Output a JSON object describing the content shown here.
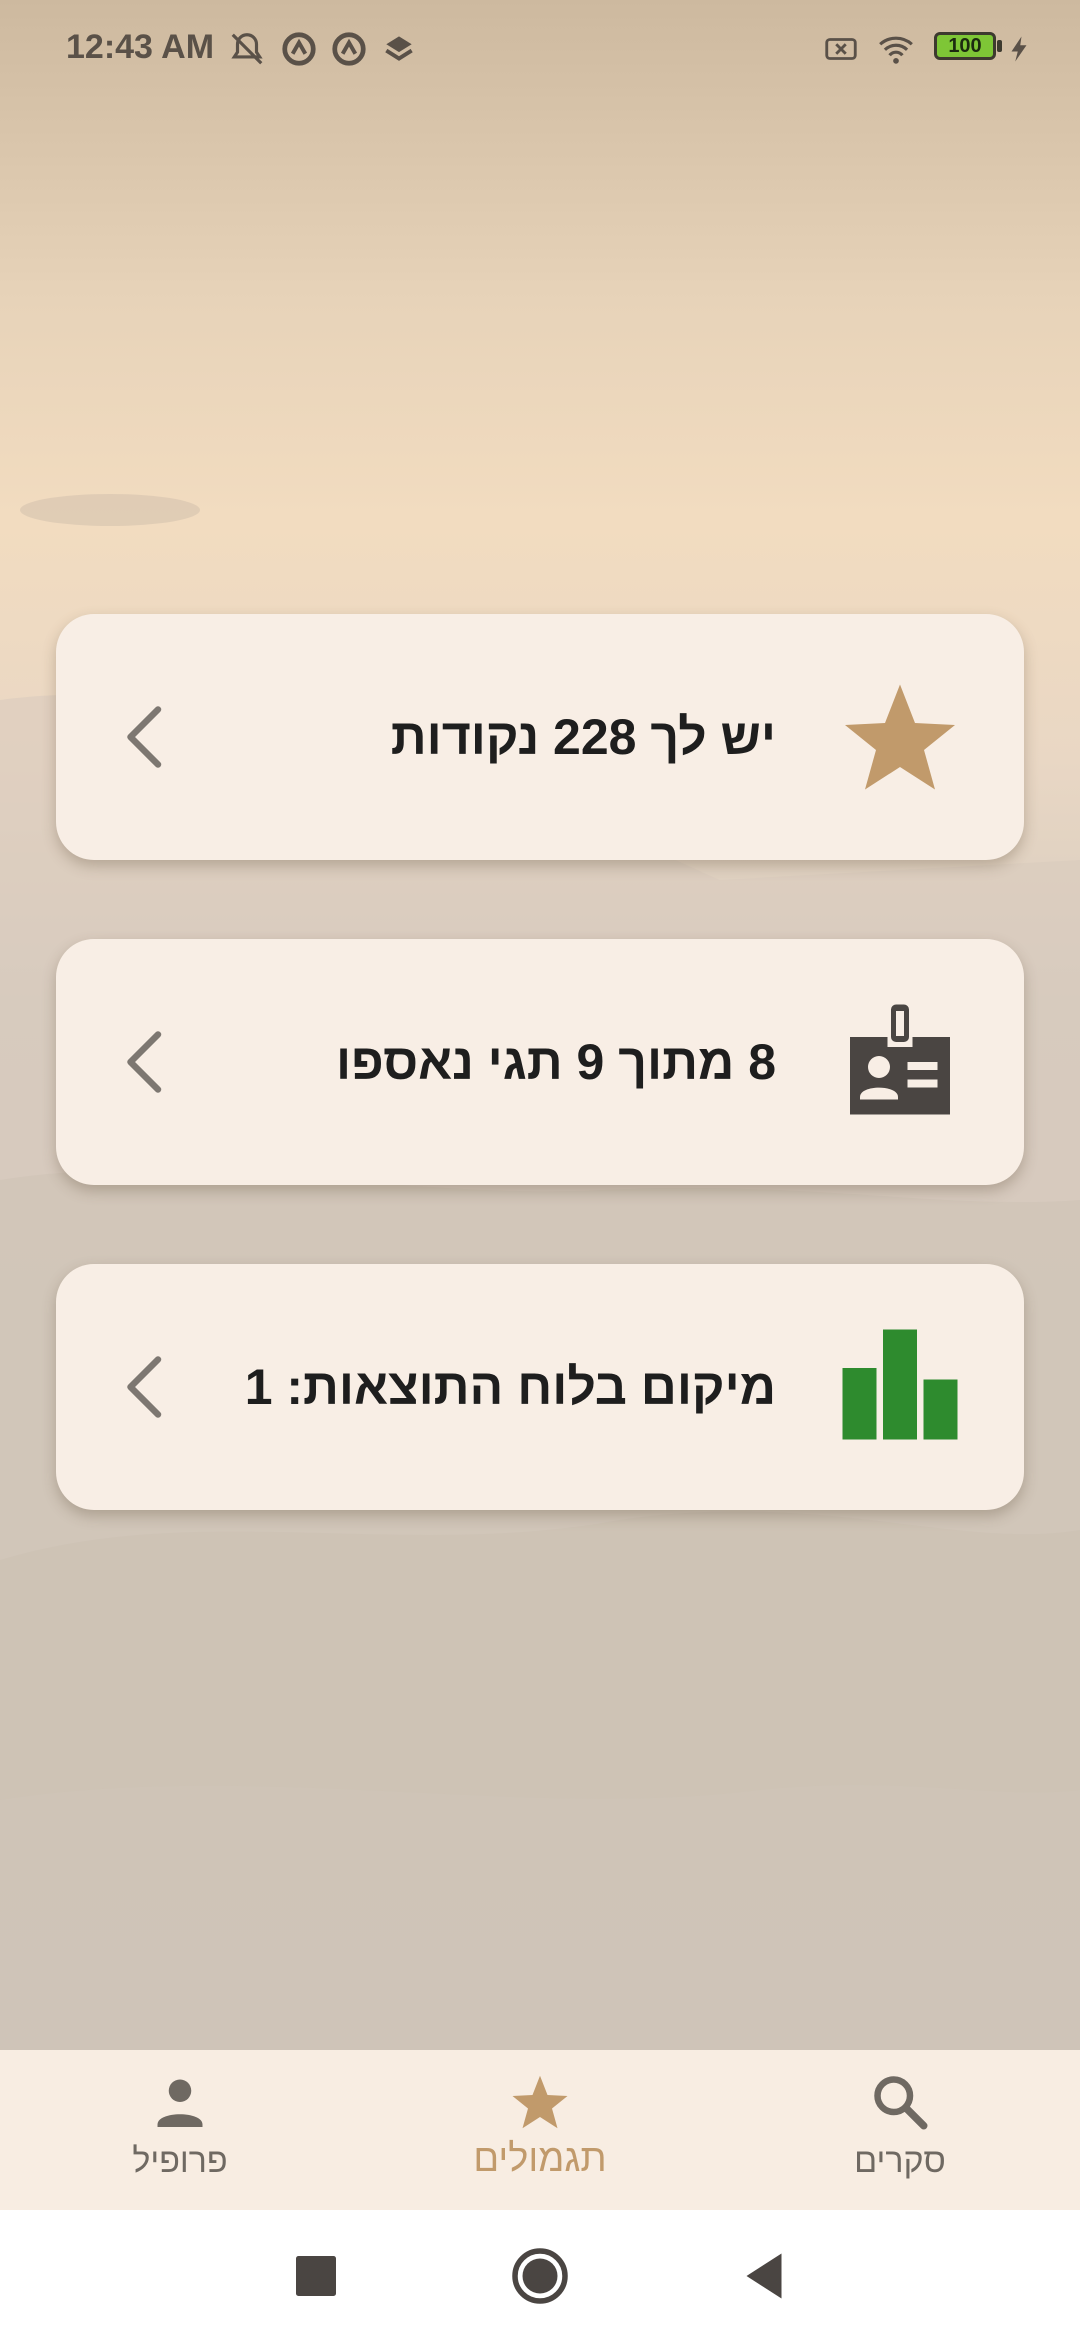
{
  "status_bar": {
    "time": "12:43 AM",
    "battery": "100",
    "icons": [
      "notifications-off-icon",
      "app-icon",
      "app-icon",
      "dropbox-icon",
      "no-sim-icon",
      "wifi-icon",
      "battery-icon",
      "charging-icon"
    ]
  },
  "cards": [
    {
      "icon": "star-icon",
      "text": "יש לך 228 נקודות",
      "icon_color": "#c19a6b"
    },
    {
      "icon": "badge-icon",
      "text": "8 מתוך 9 תגי נאספו",
      "icon_color": "#4a4542"
    },
    {
      "icon": "leaderboard-icon",
      "text": "מיקום בלוח התוצאות: 1",
      "icon_color": "#2e8b2e"
    }
  ],
  "bottom_nav": {
    "items": [
      {
        "icon": "person-icon",
        "label": "פרופיל",
        "active": false
      },
      {
        "icon": "star-icon",
        "label": "תגמולים",
        "active": true
      },
      {
        "icon": "search-icon",
        "label": "סקרים",
        "active": false
      }
    ]
  },
  "colors": {
    "accent": "#c19a6b",
    "card_bg": "#f8eee5",
    "nav_bg": "#f8ede2",
    "green": "#2e8b2e"
  }
}
